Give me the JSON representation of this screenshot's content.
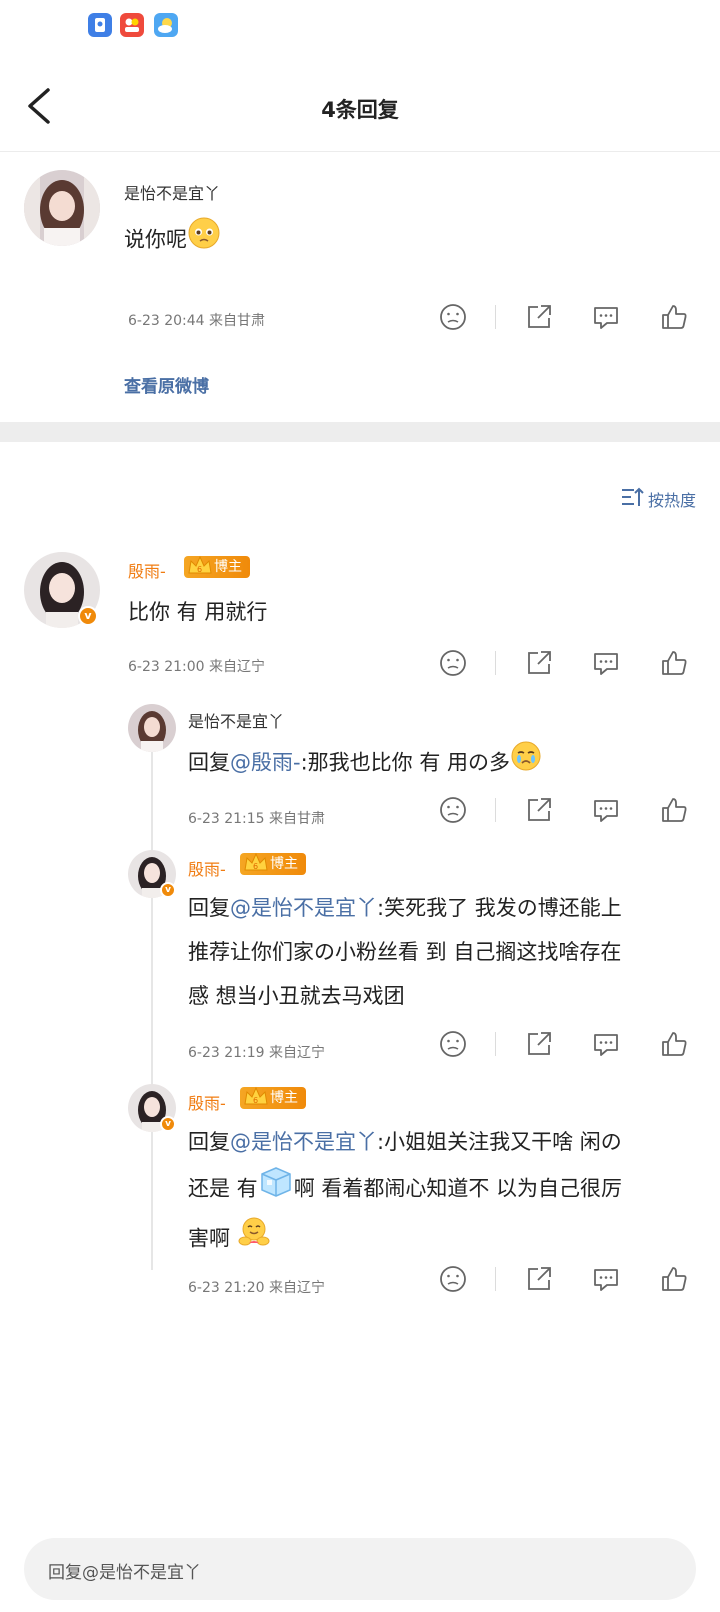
{
  "status_bar": {
    "icons": [
      "app-icon-blue",
      "app-icon-red",
      "weather-icon"
    ]
  },
  "header": {
    "title": "4条回复"
  },
  "original": {
    "user": "是怡不是宜丫",
    "text": "说你呢",
    "emoji": "pleading-face",
    "meta": "6-23  20:44   来自甘肃",
    "view_original": "查看原微博"
  },
  "sort_label": "按热度",
  "comments": [
    {
      "user": "殷雨-",
      "badge": "博主",
      "text": "比你 有 用就行",
      "meta": "6-23  21:00   来自辽宁"
    },
    {
      "user": "是怡不是宜丫",
      "prefix": "回复",
      "mention": "@殷雨-",
      "text": ":那我也比你 有 用の多",
      "emoji": "crying-face",
      "meta": "6-23  21:15   来自甘肃"
    },
    {
      "user": "殷雨-",
      "badge": "博主",
      "prefix": "回复",
      "mention": "@是怡不是宜丫",
      "text_line1": ":笑死我了  我发の博还能上",
      "text_line2": "推荐让你们家の小粉丝看 到   自己搁这找啥存在",
      "text_line3": "感  想当小丑就去马戏团",
      "meta": "6-23  21:19   来自辽宁"
    },
    {
      "user": "殷雨-",
      "badge": "博主",
      "prefix": "回复",
      "mention": "@是怡不是宜丫",
      "text_line1": ":小姐姐关注我又干啥  闲の",
      "text_line2a": "还是 有",
      "text_line2b": "啊  看着都闹心知道不  以为自己很厉",
      "text_line3": "害啊",
      "emoji_ice": "ice-cube",
      "emoji_hug": "hugging-face",
      "meta": "6-23  21:20   来自辽宁"
    }
  ],
  "reply_input": {
    "placeholder": "回复@是怡不是宜丫"
  },
  "colors": {
    "mention": "#4a6fa5",
    "orange_name": "#f07c12",
    "badge": "#f08a0a"
  }
}
